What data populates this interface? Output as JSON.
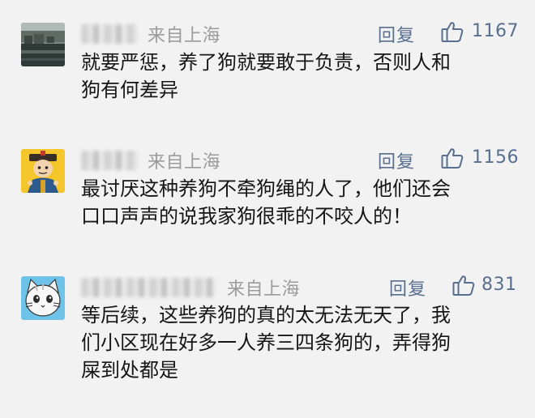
{
  "comments": [
    {
      "location": "来自上海",
      "reply_label": "回复",
      "like_count": "1167",
      "lines": [
        "就要严惩，养了狗就要敢于负责，否则人和",
        "狗有何差异"
      ]
    },
    {
      "location": "来自上海",
      "reply_label": "回复",
      "like_count": "1156",
      "lines": [
        "最讨厌这种养狗不牵狗绳的人了，他们还会",
        "口口声声的说我家狗很乖的不咬人的！"
      ]
    },
    {
      "location": "来自上海",
      "reply_label": "回复",
      "like_count": "831",
      "lines": [
        "等后续，这些养狗的真的太无法无天了，我",
        "们小区现在好多一人养三四条狗的，弄得狗",
        "屎到处都是"
      ]
    }
  ],
  "icons": {
    "like": "thumbs-up-icon",
    "avatar_1": "canal-town-photo",
    "avatar_2": "cartoon-emperor",
    "avatar_3": "cartoon-cat"
  },
  "colors": {
    "background": "#f2f2f2",
    "text": "#151515",
    "meta": "#9b9b9b",
    "action": "#586f8f"
  }
}
